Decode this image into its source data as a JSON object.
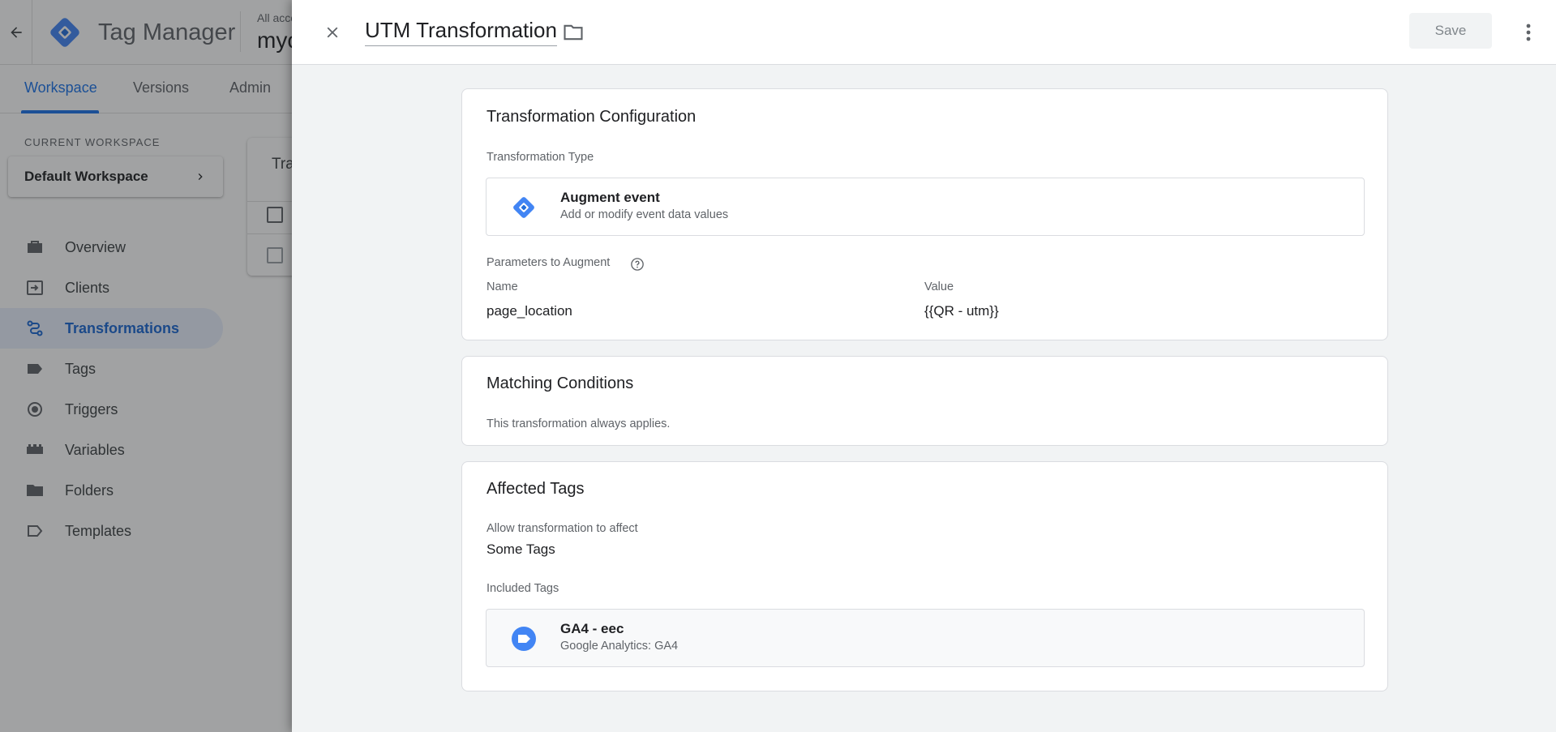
{
  "app": {
    "title": "Tag Manager",
    "account_label": "All acco",
    "account_name": "myo",
    "tabs": [
      {
        "label": "Workspace"
      },
      {
        "label": "Versions"
      },
      {
        "label": "Admin"
      }
    ],
    "current_workspace_label": "CURRENT WORKSPACE",
    "workspace_name": "Default Workspace",
    "sidebar": {
      "items": [
        {
          "label": "Overview",
          "icon": "briefcase-icon"
        },
        {
          "label": "Clients",
          "icon": "client-login-icon"
        },
        {
          "label": "Transformations",
          "icon": "transformation-icon"
        },
        {
          "label": "Tags",
          "icon": "tag-icon"
        },
        {
          "label": "Triggers",
          "icon": "trigger-icon"
        },
        {
          "label": "Variables",
          "icon": "variables-icon"
        },
        {
          "label": "Folders",
          "icon": "folder-icon"
        },
        {
          "label": "Templates",
          "icon": "template-icon"
        }
      ]
    },
    "bg_card_title": "Tra"
  },
  "panel": {
    "title": "UTM Transformation",
    "save_label": "Save",
    "config": {
      "title": "Transformation Configuration",
      "type_label": "Transformation Type",
      "type_name": "Augment event",
      "type_desc": "Add or modify event data values",
      "params_label": "Parameters to Augment",
      "col_name": "Name",
      "col_value": "Value",
      "param_name": "page_location",
      "param_value": "{{QR - utm}}"
    },
    "matching": {
      "title": "Matching Conditions",
      "text": "This transformation always applies."
    },
    "affected": {
      "title": "Affected Tags",
      "allow_label": "Allow transformation to affect",
      "allow_value": "Some Tags",
      "included_label": "Included Tags",
      "tag_name": "GA4 - eec",
      "tag_type": "Google Analytics: GA4"
    }
  },
  "colors": {
    "accent": "#1a73e8",
    "scrim": "rgba(32,33,36,0.42)",
    "panel_bg": "#f1f3f4"
  }
}
